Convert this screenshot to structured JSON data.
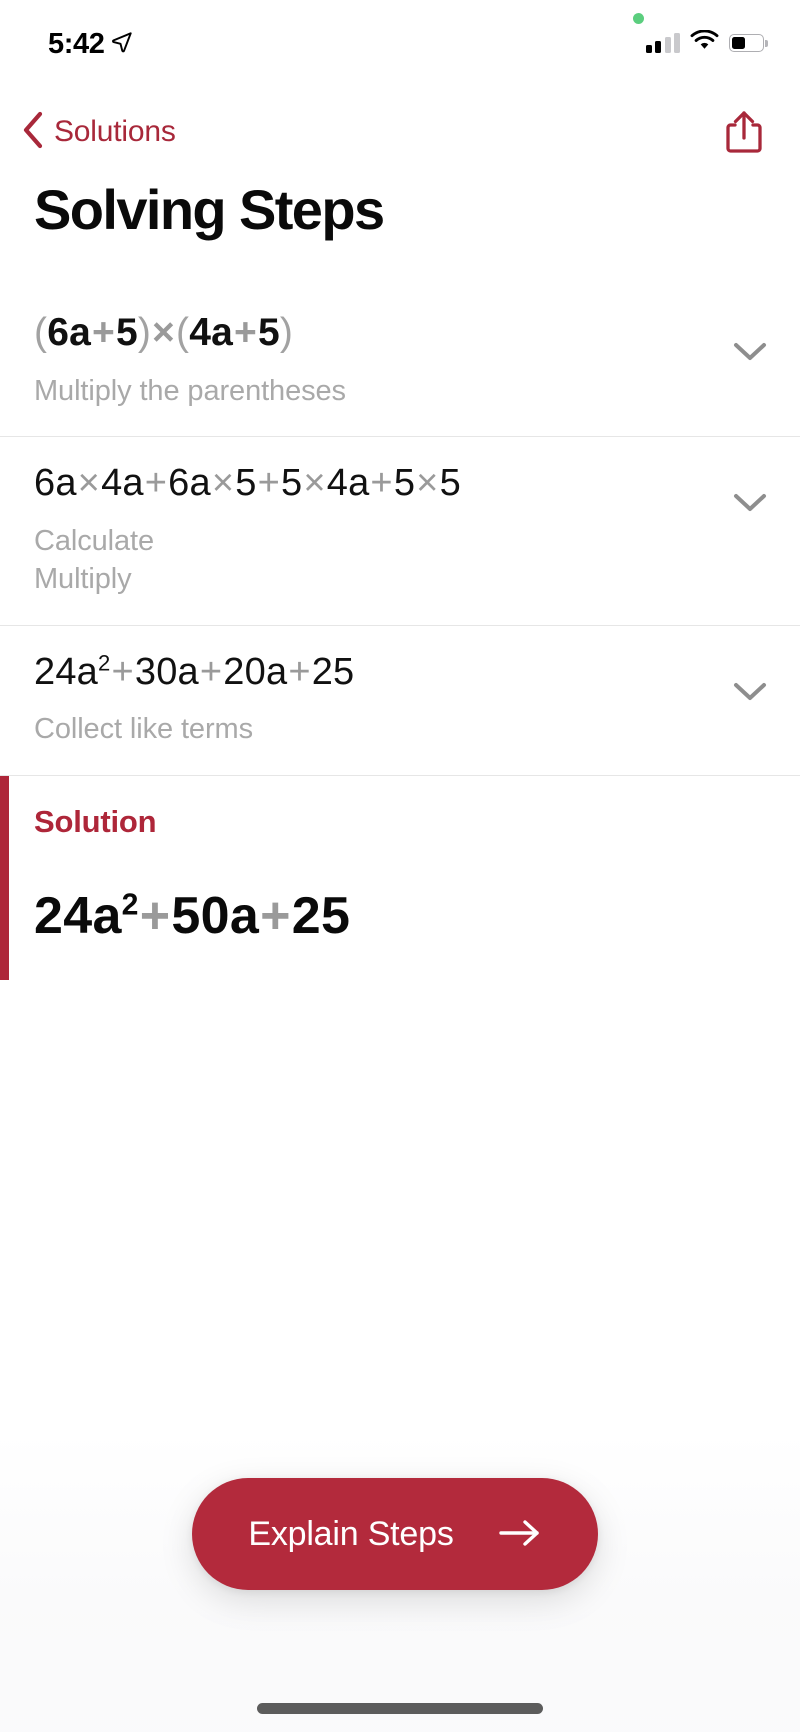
{
  "status_bar": {
    "time": "5:42",
    "location_icon": "location-arrow-icon",
    "privacy_icon": "green-privacy-dot",
    "signal_icon": "cellular-signal-icon",
    "wifi_icon": "wifi-icon",
    "battery_icon": "battery-icon",
    "battery_level_percent": 45
  },
  "nav": {
    "back_label": "Solutions",
    "back_icon": "chevron-left-icon",
    "share_icon": "share-icon",
    "accent_color": "#A8283A"
  },
  "page": {
    "title": "Solving Steps"
  },
  "steps": [
    {
      "expression_plain": "(6a+5)×(4a+5)",
      "description": "Multiply the parentheses",
      "chevron_icon": "chevron-down-icon",
      "emphasis": "bold"
    },
    {
      "expression_plain": "6a×4a+6a×5+5×4a+5×5",
      "description": "Calculate\nMultiply",
      "description_line1": "Calculate",
      "description_line2": "Multiply",
      "chevron_icon": "chevron-down-icon",
      "emphasis": "regular"
    },
    {
      "expression_plain": "24a²+30a+20a+25",
      "description": "Collect like terms",
      "chevron_icon": "chevron-down-icon",
      "emphasis": "regular"
    }
  ],
  "solution": {
    "label": "Solution",
    "expression_plain": "24a²+50a+25",
    "accent_color": "#AE2639"
  },
  "cta": {
    "label": "Explain Steps",
    "arrow_icon": "arrow-right-icon",
    "background_color": "#B32A3C",
    "text_color": "#FFFFFF"
  },
  "home_indicator": {
    "name": "home-indicator"
  }
}
